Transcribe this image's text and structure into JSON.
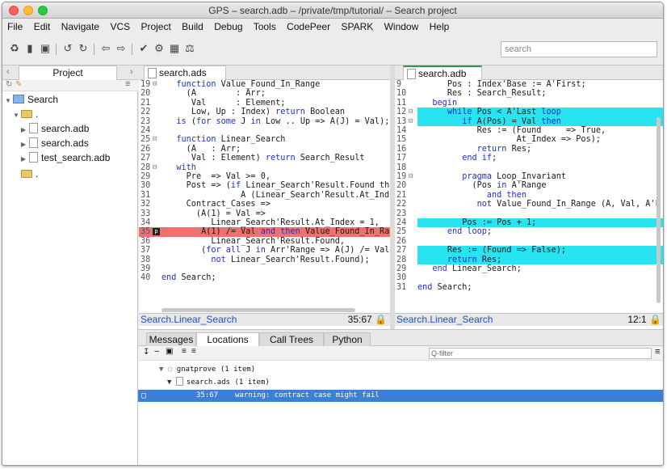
{
  "window": {
    "title": "GPS – search.adb – /private/tmp/tutorial/ – Search project"
  },
  "menu": [
    "File",
    "Edit",
    "Navigate",
    "VCS",
    "Project",
    "Build",
    "Debug",
    "Tools",
    "CodePeer",
    "SPARK",
    "Window",
    "Help"
  ],
  "toolbar": {
    "search_placeholder": "search"
  },
  "project": {
    "tab_label": "Project",
    "root": "Search",
    "dir": ".",
    "files": [
      "search.adb",
      "search.ads",
      "test_search.adb"
    ],
    "obj_dir": "."
  },
  "left_editor": {
    "tab": "search.ads",
    "lines": [
      {
        "n": "19",
        "t": "   function Value_Found_In_Range"
      },
      {
        "n": "20",
        "t": "     (A        : Arr;"
      },
      {
        "n": "21",
        "t": "      Val      : Element;"
      },
      {
        "n": "22",
        "t": "      Low, Up : Index) return Boolean"
      },
      {
        "n": "23",
        "t": "   is (for some J in Low .. Up => A(J) = Val);"
      },
      {
        "n": "24",
        "t": ""
      },
      {
        "n": "25",
        "t": "   function Linear_Search"
      },
      {
        "n": "26",
        "t": "     (A   : Arr;"
      },
      {
        "n": "27",
        "t": "      Val : Element) return Search_Result"
      },
      {
        "n": "28",
        "t": "   with"
      },
      {
        "n": "29",
        "t": "     Pre  => Val >= 0,"
      },
      {
        "n": "30",
        "t": "     Post => (if Linear_Search'Result.Found th"
      },
      {
        "n": "31",
        "t": "                A (Linear_Search'Result.At_Ind"
      },
      {
        "n": "32",
        "t": "     Contract_Cases =>"
      },
      {
        "n": "33",
        "t": "       (A(1) = Val =>"
      },
      {
        "n": "34",
        "t": "          Linear_Search'Result.At_Index = 1,"
      },
      {
        "n": "35",
        "t": "        A(1) /= Val and then Value_Found_In_Ra"
      },
      {
        "n": "36",
        "t": "          Linear_Search'Result.Found,"
      },
      {
        "n": "37",
        "t": "        (for all J in Arr'Range => A(J) /= Val"
      },
      {
        "n": "38",
        "t": "          not Linear_Search'Result.Found);"
      },
      {
        "n": "39",
        "t": ""
      },
      {
        "n": "40",
        "t": "end Search;"
      }
    ],
    "status_left": "Search.Linear_Search",
    "status_right": "35:67"
  },
  "right_editor": {
    "tab": "search.adb",
    "lines": [
      {
        "n": "9",
        "t": "      Pos : Index'Base := A'First;"
      },
      {
        "n": "10",
        "t": "      Res : Search_Result;"
      },
      {
        "n": "11",
        "t": "   begin"
      },
      {
        "n": "12",
        "t": "      while Pos < A'Last loop"
      },
      {
        "n": "13",
        "t": "         if A(Pos) = Val then"
      },
      {
        "n": "14",
        "t": "            Res := (Found     => True,"
      },
      {
        "n": "15",
        "t": "                    At_Index => Pos);"
      },
      {
        "n": "16",
        "t": "            return Res;"
      },
      {
        "n": "17",
        "t": "         end if;"
      },
      {
        "n": "18",
        "t": ""
      },
      {
        "n": "19",
        "t": "         pragma Loop_Invariant"
      },
      {
        "n": "20",
        "t": "           (Pos in A'Range"
      },
      {
        "n": "21",
        "t": "              and then"
      },
      {
        "n": "22",
        "t": "            not Value_Found_In_Range (A, Val, A'F"
      },
      {
        "n": "23",
        "t": ""
      },
      {
        "n": "24",
        "t": "         Pos := Pos + 1;"
      },
      {
        "n": "25",
        "t": "      end loop;"
      },
      {
        "n": "26",
        "t": ""
      },
      {
        "n": "27",
        "t": "      Res := (Found => False);"
      },
      {
        "n": "28",
        "t": "      return Res;"
      },
      {
        "n": "29",
        "t": "   end Linear_Search;"
      },
      {
        "n": "30",
        "t": ""
      },
      {
        "n": "31",
        "t": "end Search;"
      }
    ],
    "status_left": "Search.Linear_Search",
    "status_right": "12:1"
  },
  "bottom": {
    "tabs": [
      "Messages",
      "Locations",
      "Call Trees",
      "Python"
    ],
    "filter_placeholder": "Q-filter",
    "group": "gnatprove (1 item)",
    "file": "search.ads (1 item)",
    "location": "35:67",
    "message": "warning: contract case might fail"
  },
  "colors": {
    "red_highlight": "#f07070",
    "cyan_highlight": "#28e4f0",
    "selection": "#3b7fd6",
    "keyword": "#1f30c8"
  }
}
